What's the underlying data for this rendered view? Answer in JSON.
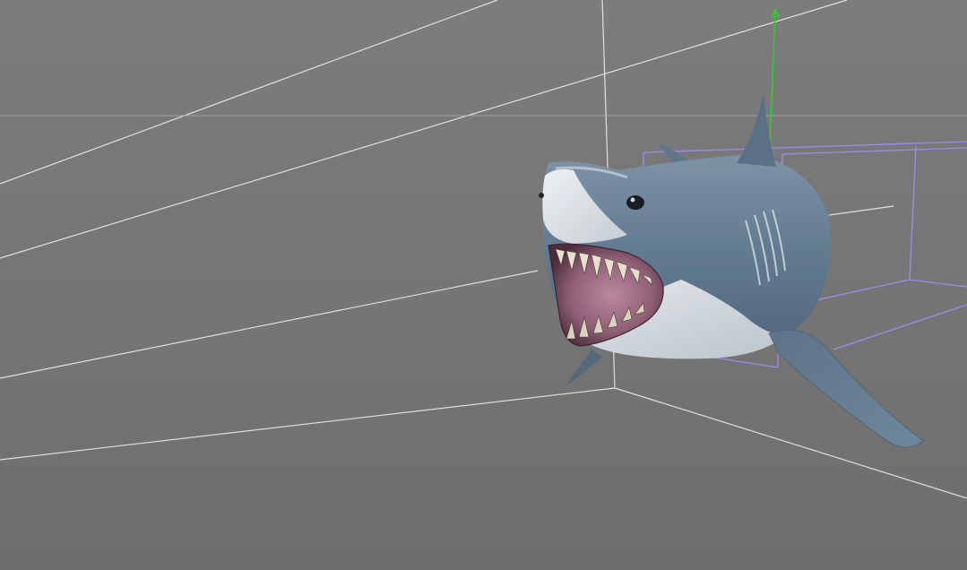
{
  "viewport": {
    "background_color": "#777777",
    "grid_color": "#e6efe6",
    "horizon_color": "#a9b0b6",
    "bounding_box_color": "#9d8cf0",
    "y_axis_gizmo_color": "#2fd12f"
  },
  "scene": {
    "object": "shark-model",
    "selected": true
  }
}
